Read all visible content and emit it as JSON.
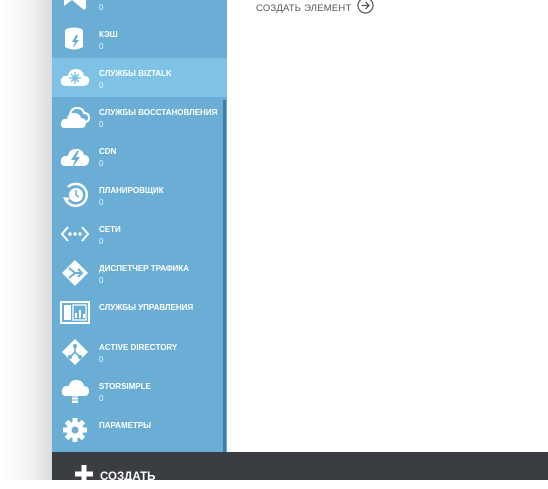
{
  "sidebar": {
    "items": [
      {
        "label": "",
        "count": "0",
        "icon": "visual-studio-icon"
      },
      {
        "label": "КЭШ",
        "count": "0",
        "icon": "cache-icon"
      },
      {
        "label": "СЛУЖБЫ BIZTALK",
        "count": "0",
        "icon": "biztalk-icon"
      },
      {
        "label": "СЛУЖБЫ ВОССТАНОВЛЕНИЯ",
        "count": "0",
        "icon": "recovery-cloud-icon"
      },
      {
        "label": "CDN",
        "count": "0",
        "icon": "cdn-icon"
      },
      {
        "label": "ПЛАНИРОВЩИК",
        "count": "0",
        "icon": "scheduler-icon"
      },
      {
        "label": "СЕТИ",
        "count": "0",
        "icon": "network-icon"
      },
      {
        "label": "ДИСПЕТЧЕР ТРАФИКА",
        "count": "0",
        "icon": "traffic-manager-icon"
      },
      {
        "label": "СЛУЖБЫ УПРАВЛЕНИЯ",
        "count": "",
        "icon": "management-services-icon"
      },
      {
        "label": "ACTIVE DIRECTORY",
        "count": "0",
        "icon": "active-directory-icon"
      },
      {
        "label": "STORSIMPLE",
        "count": "0",
        "icon": "storsimple-icon"
      },
      {
        "label": "ПАРАМЕТРЫ",
        "count": "",
        "icon": "settings-gear-icon"
      }
    ],
    "active_index": 2
  },
  "main": {
    "create_item_label": "СОЗДАТЬ ЭЛЕМЕНТ"
  },
  "bottom_bar": {
    "create_label": "СОЗДАТЬ"
  },
  "colors": {
    "sidebar_bg": "#6aaed6",
    "sidebar_active": "#7ec3e6",
    "bottom_bar_bg": "#3a3d42"
  }
}
